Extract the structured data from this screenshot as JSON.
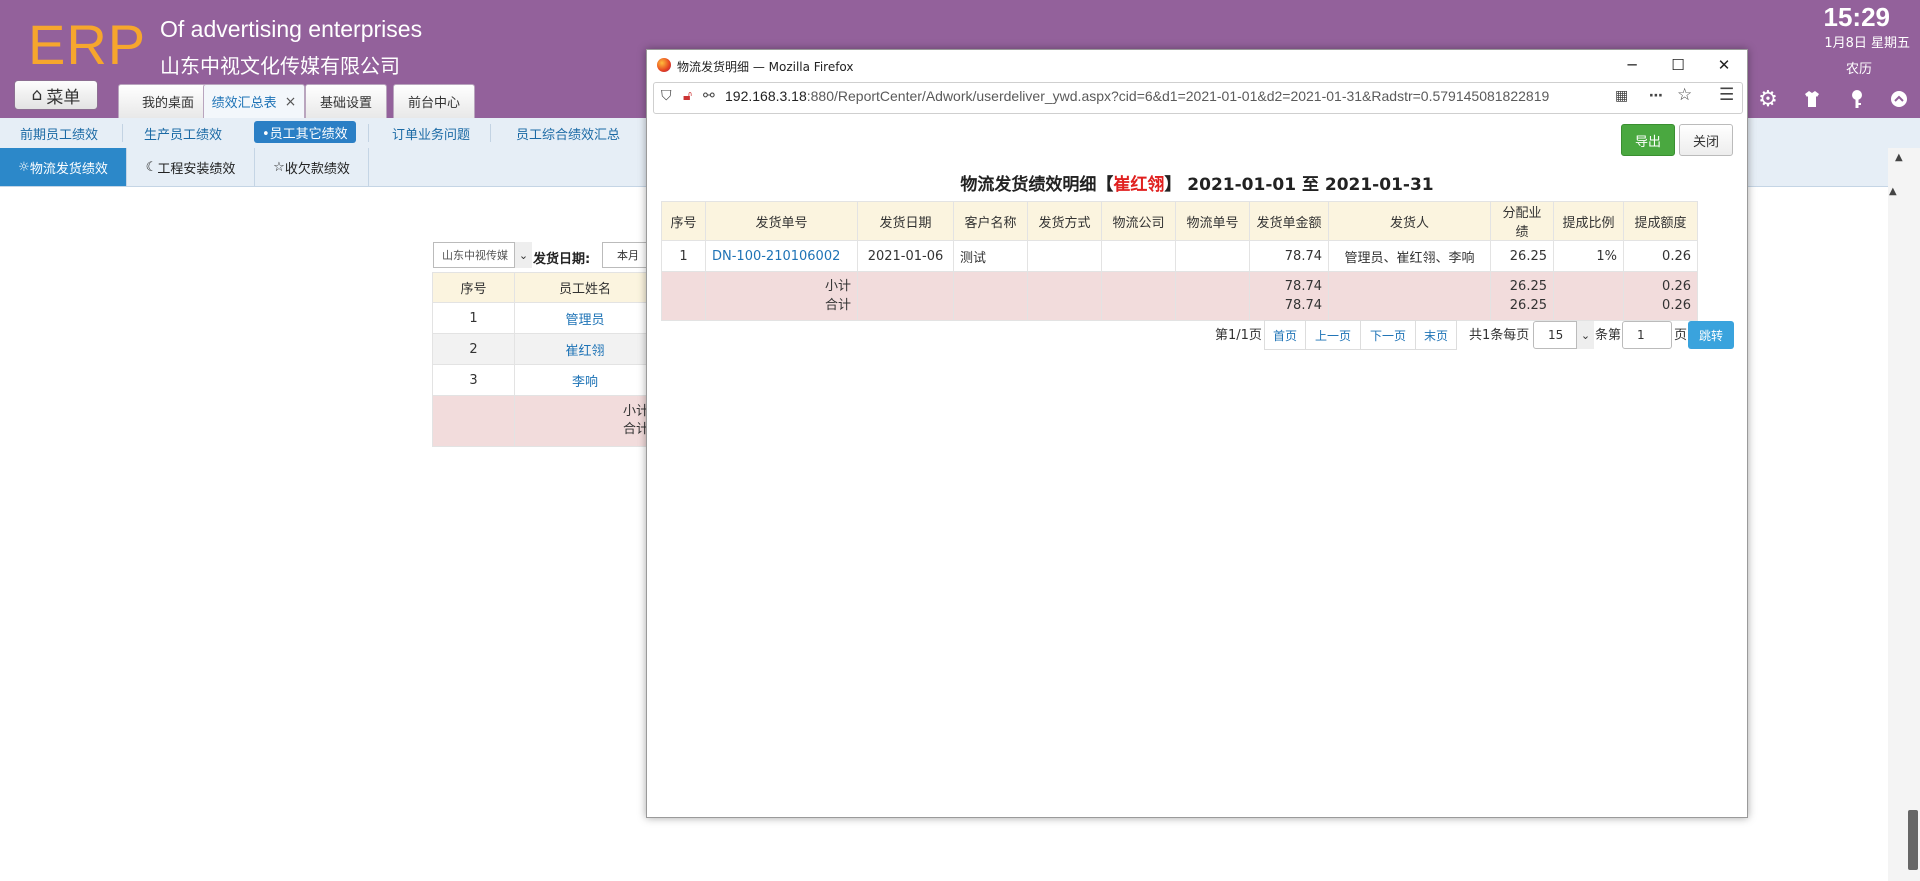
{
  "header": {
    "logo": "ERP",
    "subtitle_en": "Of advertising enterprises",
    "subtitle_cn": "山东中视文化传媒有限公司",
    "clock": "15:29",
    "date": "1月8日 星期五",
    "lunar": "农历"
  },
  "menu_button": "菜单",
  "top_tabs": [
    {
      "label": "我的桌面"
    },
    {
      "label": "绩效汇总表",
      "close": "×"
    },
    {
      "label": "基础设置"
    },
    {
      "label": "前台中心"
    }
  ],
  "second_bar": [
    "前期员工绩效",
    "生产员工绩效",
    "•员工其它绩效",
    "订单业务问题",
    "员工综合绩效汇总"
  ],
  "third_bar": [
    "物流发货绩效",
    "工程安装绩效",
    "收欠款绩效"
  ],
  "background_page": {
    "company_select": "山东中视传媒",
    "date_label": "发货日期:",
    "date_value": "本月",
    "columns": [
      "序号",
      "员工姓名"
    ],
    "rows": [
      {
        "no": "1",
        "name": "管理员"
      },
      {
        "no": "2",
        "name": "崔红翎"
      },
      {
        "no": "3",
        "name": "李响"
      }
    ],
    "subtotal_label": "小计",
    "total_label": "合计"
  },
  "popup": {
    "window_title": "物流发货明细 — Mozilla Firefox",
    "url_host": "192.168.3.18",
    "url_rest": ":880/ReportCenter/Adwork/userdeliver_ywd.aspx?cid=6&d1=2021-01-01&d2=2021-01-31&Radstr=0.579145081822819",
    "export_button": "导出",
    "close_button": "关闭",
    "report_title_prefix": "物流发货绩效明细【",
    "report_person": "崔红翎",
    "report_title_suffix": "】 2021-01-01 至 2021-01-31",
    "columns": [
      "序号",
      "发货单号",
      "发货日期",
      "客户名称",
      "发货方式",
      "物流公司",
      "物流单号",
      "发货单金额",
      "发货人",
      "分配业绩",
      "提成比例",
      "提成额度"
    ],
    "rows": [
      {
        "no": "1",
        "order_no": "DN-100-210106002",
        "date": "2021-01-06",
        "customer": "测试",
        "method": "",
        "company": "",
        "tracking": "",
        "amount": "78.74",
        "shipper": "管理员、崔红翎、李响",
        "allocated": "26.25",
        "rate": "1%",
        "commission": "0.26"
      }
    ],
    "subtotal": {
      "label": "小计",
      "amount": "78.74",
      "allocated": "26.25",
      "commission": "0.26"
    },
    "total": {
      "label": "合计",
      "amount": "78.74",
      "allocated": "26.25",
      "commission": "0.26"
    },
    "pager": {
      "page_info": "第1/1页",
      "first": "首页",
      "prev": "上一页",
      "next": "下一页",
      "last": "末页",
      "count_text": "共1条每页",
      "page_size": "15",
      "per_text": "条第",
      "page_input": "1",
      "page_suffix": "页",
      "go": "跳转"
    }
  },
  "colors": {
    "header_purple": "#93619b",
    "logo_orange": "#f6a62d",
    "link_blue": "#1e73b6",
    "highlight_red": "#e11e1e",
    "export_green": "#4aa840"
  }
}
